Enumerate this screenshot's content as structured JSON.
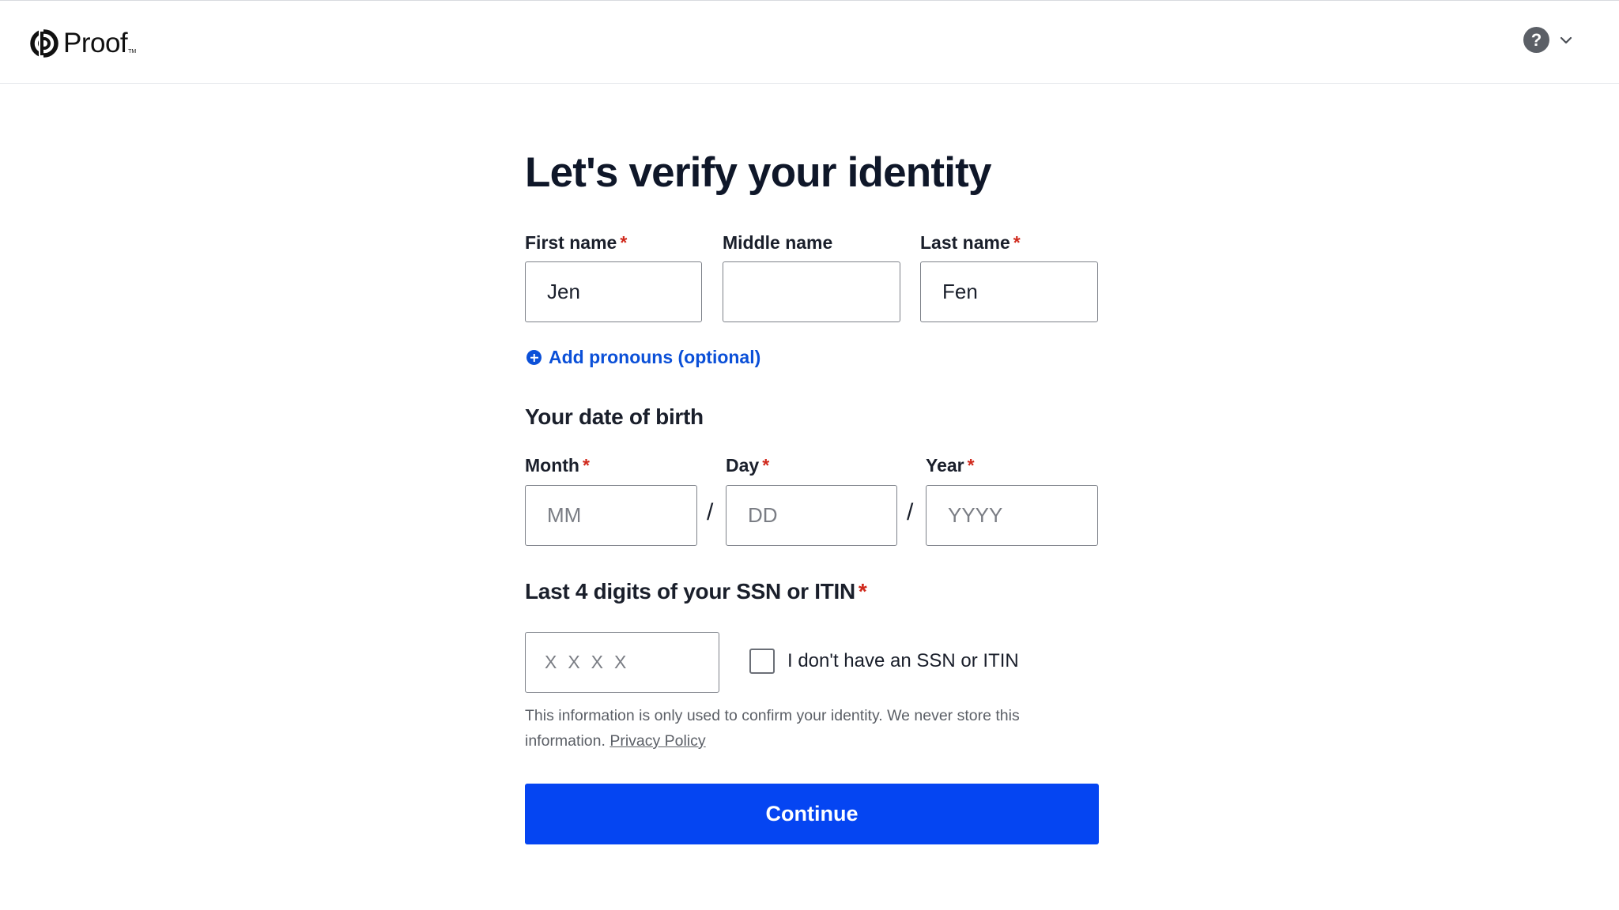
{
  "header": {
    "logo_text": "Proof",
    "logo_tm": "TM",
    "help_icon": "question-mark-icon",
    "help_glyph": "?",
    "chevron_icon": "chevron-down-icon"
  },
  "form": {
    "title": "Let's verify your identity",
    "required_mark": "*",
    "first_name": {
      "label": "First name",
      "value": "Jen"
    },
    "middle_name": {
      "label": "Middle name",
      "value": ""
    },
    "last_name": {
      "label": "Last name",
      "value": "Fen"
    },
    "add_pronouns": "Add pronouns (optional)",
    "dob": {
      "title": "Your date of birth",
      "month": {
        "label": "Month",
        "placeholder": "MM"
      },
      "day": {
        "label": "Day",
        "placeholder": "DD"
      },
      "year": {
        "label": "Year",
        "placeholder": "YYYY"
      },
      "separator": "/"
    },
    "ssn": {
      "title": "Last 4 digits of your SSN or ITIN",
      "placeholder": "XXXX",
      "no_ssn_label": "I don't have an SSN or ITIN"
    },
    "info_text": "This information is only used to confirm your identity. We never store this information.",
    "privacy_link": "Privacy Policy",
    "continue_label": "Continue"
  },
  "colors": {
    "accent": "#0545f2",
    "link": "#0b50d8",
    "required": "#d0291c"
  }
}
